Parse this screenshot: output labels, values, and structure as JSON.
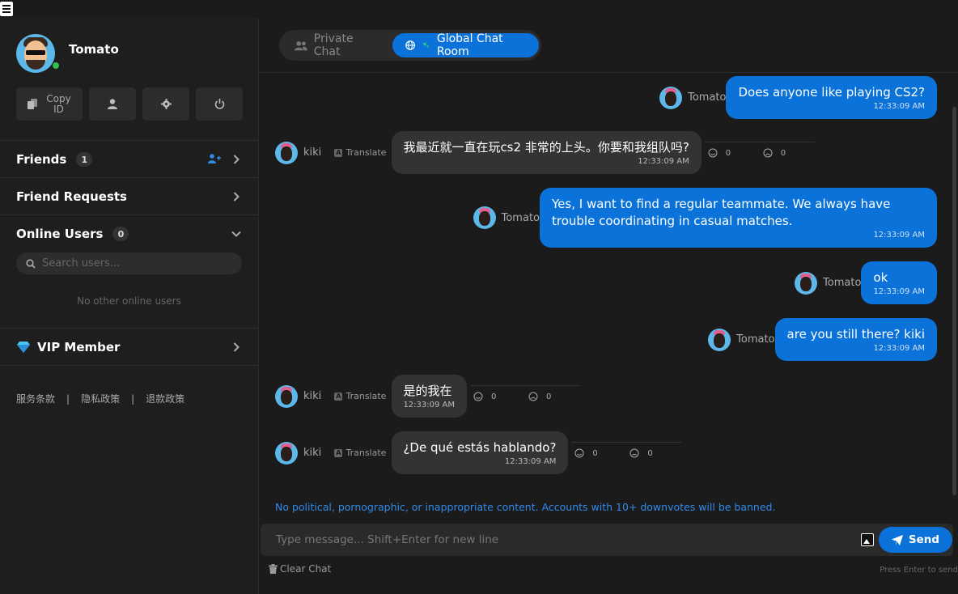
{
  "profile": {
    "name": "Tomato",
    "status_color": "#2fbf4f"
  },
  "actions": {
    "copy_id": "Copy ID",
    "profile_icon": "user-icon",
    "settings_icon": "gear-icon",
    "logout_icon": "power-icon"
  },
  "sidebar": {
    "friends": {
      "label": "Friends",
      "count": "1"
    },
    "friend_requests": {
      "label": "Friend Requests"
    },
    "online_users": {
      "label": "Online Users",
      "count": "0",
      "search_placeholder": "Search users...",
      "empty": "No other online users"
    },
    "vip": {
      "label": "VIP Member"
    },
    "footer": {
      "terms": "服务条款",
      "privacy": "隐私政策",
      "refund": "退款政策",
      "sep": "|"
    }
  },
  "tabs": {
    "private": "Private Chat",
    "global": "Global Chat Room"
  },
  "translate_label": "Translate",
  "messages": [
    {
      "sender": "Tomato",
      "text": "Does anyone like playing CS2?",
      "time": "12:33:09 AM"
    },
    {
      "sender": "kiki",
      "text": "我最近就一直在玩cs2 非常的上头。你要和我组队吗?",
      "time": "12:33:09 AM",
      "likes": "0",
      "dislikes": "0"
    },
    {
      "sender": "Tomato",
      "text": "Yes, I want to find a regular teammate. We always have trouble coordinating in casual matches.",
      "time": "12:33:09 AM"
    },
    {
      "sender": "Tomato",
      "text": "ok",
      "time": "12:33:09 AM"
    },
    {
      "sender": "Tomato",
      "text": "are you still there? kiki",
      "time": "12:33:09 AM"
    },
    {
      "sender": "kiki",
      "text": "是的我在",
      "time": "12:33:09 AM",
      "likes": "0",
      "dislikes": "0"
    },
    {
      "sender": "kiki",
      "text": "¿De qué estás hablando?",
      "time": "12:33:09 AM",
      "likes": "0",
      "dislikes": "0"
    }
  ],
  "notice": "No political, pornographic, or inappropriate content. Accounts with 10+ downvotes will be banned.",
  "composer": {
    "placeholder": "Type message... Shift+Enter for new line",
    "send": "Send",
    "clear": "Clear Chat",
    "hint": "Press Enter to send"
  },
  "colors": {
    "accent": "#0a72d8",
    "notice": "#2f8ae8"
  }
}
